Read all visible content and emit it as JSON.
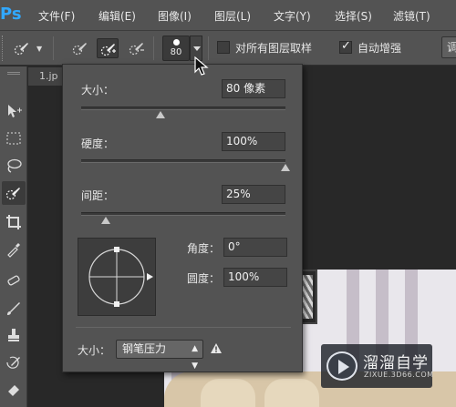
{
  "app": {
    "logo": "Ps"
  },
  "menu": {
    "items": [
      "文件(F)",
      "编辑(E)",
      "图像(I)",
      "图层(L)",
      "文字(Y)",
      "选择(S)",
      "滤镜(T)"
    ]
  },
  "options_bar": {
    "brush_size": "80",
    "sample_all_layers": {
      "label": "对所有图层取样",
      "checked": false
    },
    "auto_enhance": {
      "label": "自动增强",
      "checked": true
    },
    "refine_edge_label": "调"
  },
  "document": {
    "tab_title": "1.jp"
  },
  "brush_popup": {
    "size": {
      "label": "大小：",
      "value": "80 像素",
      "slider_fraction": 0.39
    },
    "hardness": {
      "label": "硬度：",
      "value": "100%",
      "slider_fraction": 1.0
    },
    "spacing": {
      "label": "间距：",
      "value": "25%",
      "slider_fraction": 0.12
    },
    "angle": {
      "label": "角度：",
      "value": "0°"
    },
    "roundness": {
      "label": "圆度：",
      "value": "100%"
    },
    "size_control": {
      "label": "大小：",
      "selected": "钢笔压力"
    }
  },
  "watermark": {
    "title": "溜溜自学",
    "url": "ZIXUE.3D66.COM"
  },
  "colors": {
    "accent": "#31a8ff",
    "panel": "#535353",
    "field": "#454545"
  }
}
